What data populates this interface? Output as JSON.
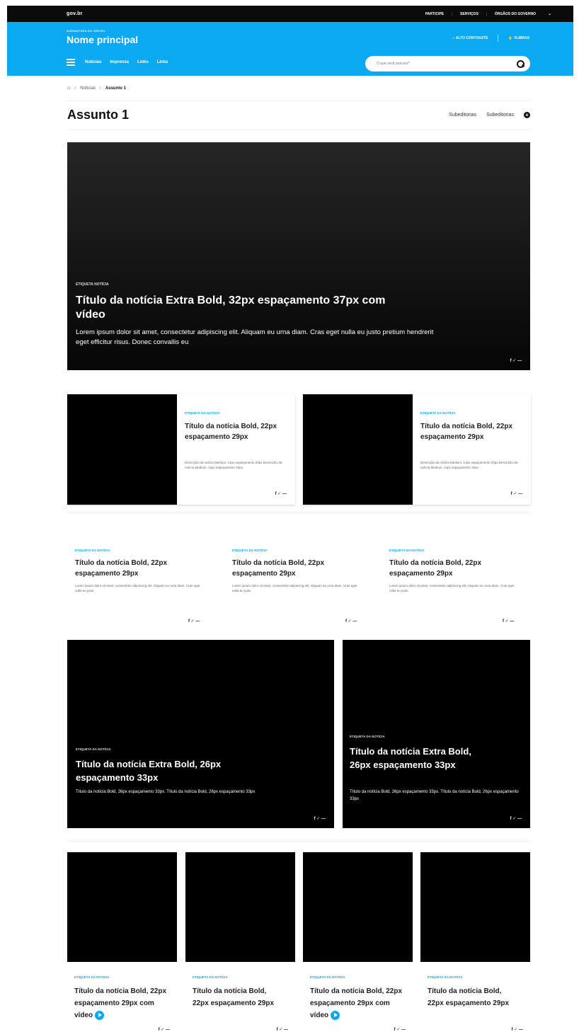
{
  "topbar": {
    "brand": "gov.br",
    "links": [
      "PARTICIPE",
      "SERVIÇOS",
      "ÓRGÃOS DO GOVERNO"
    ],
    "chevron": "⌄"
  },
  "header": {
    "subtitle": "ASSINATURA DO ÓRGÃO",
    "title": "Nome principal",
    "links": [
      "ALTO CONTRASTE",
      "VLIBRAS"
    ],
    "nav": [
      "Notícias",
      "Imprensa",
      "Links",
      "Links"
    ],
    "search_placeholder": "O que você procura?"
  },
  "breadcrumb": {
    "home_icon": "home-icon",
    "items": [
      "Notícias",
      "Assunto 1"
    ]
  },
  "page": {
    "title": "Assunto 1",
    "subeditorias": [
      "Subeditorias",
      "Subeditorias"
    ],
    "plus": "+"
  },
  "share": "f ✓ —",
  "hero": {
    "tag": "ETIQUETA NOTÍCIA",
    "title": "Título da notícia Extra Bold, 32px espaçamento 37px com vídeo",
    "text": "Lorem ipsum dolor sit amet, consectetur adipiscing elit. Aliquam eu urna diam. Cras eget nulla eu justo pretium hendrerit eget efficitur risus. Donec convallis eu"
  },
  "cards2": [
    {
      "tag": "ETIQUETA DA NOTÍCIA",
      "title": "Título da notícia Bold, 22px espaçamento 29px",
      "text": "Descrição da notícia Medium, 14px espaçamento 20px Descrição da notícia Medium, 14px espaçamento 20px"
    },
    {
      "tag": "ETIQUETA DA NOTÍCIA",
      "title": "Título da notícia Bold, 22px espaçamento 29px",
      "text": "Descrição da notícia Medium, 14px espaçamento 20px Descrição da notícia Medium, 14px espaçamento 20px"
    }
  ],
  "cards3": [
    {
      "tag": "ETIQUETA DA NOTÍCIA",
      "title": "Título da notícia Bold, 22px espaçamento 29px",
      "text": "Lorem ipsum dolor sit amet, consectetur adipiscing elit. Aliquam eu urna diam. Cras eget nulla eu justo"
    },
    {
      "tag": "ETIQUETA DA NOTÍCIA",
      "title": "Título da notícia Bold, 22px espaçamento 29px",
      "text": "Lorem ipsum dolor sit amet, consectetur adipiscing elit. Aliquam eu urna diam. Cras eget nulla eu justo"
    },
    {
      "tag": "ETIQUETA DA NOTÍCIA",
      "title": "Título da notícia Bold, 22px espaçamento 29px",
      "text": "Lorem ipsum dolor sit amet, consectetur adipiscing elit. Aliquam eu urna diam. Cras eget nulla eu justo"
    }
  ],
  "big": [
    {
      "tag": "ETIQUETA DA NOTÍCIA",
      "title": "Título da notícia Extra Bold, 26px espaçamento 33px",
      "text": "Título da notícia Bold, 26px espaçamento 33px. Título da notícia Bold, 26px espaçamento 33px"
    },
    {
      "tag": "ETIQUETA DA NOTÍCIA",
      "title": "Título da notícia Extra Bold, 26px espaçamento 33px",
      "text": "Título da notícia Bold, 26px espaçamento 33px. Título da notícia Bold, 26px espaçamento 33px"
    }
  ],
  "cards4": [
    {
      "tag": "ETIQUETA DA NOTÍCIA",
      "title": "Título da notícia Bold, 22px espaçamento 29px com vídeo"
    },
    {
      "tag": "ETIQUETA DA NOTÍCIA",
      "title": "Título da notícia Bold, 22px espaçamento 29px"
    },
    {
      "tag": "ETIQUETA DA NOTÍCIA",
      "title": "Título da notícia Bold, 22px espaçamento 29px com vídeo"
    },
    {
      "tag": "ETIQUETA DA NOTÍCIA",
      "title": "Título da notícia Bold, 22px espaçamento 29px"
    }
  ],
  "colors": {
    "accent": "#0aa9f2",
    "topbar": "#0b0b0b",
    "card": "#000000"
  }
}
